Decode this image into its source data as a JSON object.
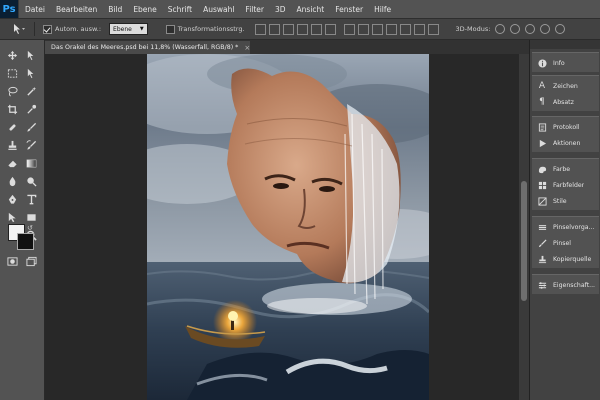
{
  "app": {
    "logo": "Ps"
  },
  "menu": [
    "Datei",
    "Bearbeiten",
    "Bild",
    "Ebene",
    "Schrift",
    "Auswahl",
    "Filter",
    "3D",
    "Ansicht",
    "Fenster",
    "Hilfe"
  ],
  "options": {
    "auto_select_label": "Autom. ausw.:",
    "auto_select_checked": true,
    "auto_select_value": "Ebene",
    "transform_label": "Transformationsstrg.",
    "transform_checked": false,
    "mode_3d_label": "3D-Modus:"
  },
  "document": {
    "tab_title": "Das Orakel des Meeres.psd bei 11,8% (Wasserfall, RGB/8) *",
    "close_glyph": "×"
  },
  "panels": [
    {
      "label": "Info",
      "icon": "info-icon"
    },
    {
      "label": "Zeichen",
      "icon": "character-icon"
    },
    {
      "label": "Absatz",
      "icon": "paragraph-icon"
    },
    {
      "label": "Protokoll",
      "icon": "history-icon"
    },
    {
      "label": "Aktionen",
      "icon": "actions-play-icon"
    },
    {
      "label": "Farbe",
      "icon": "color-icon"
    },
    {
      "label": "Farbfelder",
      "icon": "swatches-icon"
    },
    {
      "label": "Stile",
      "icon": "styles-icon"
    },
    {
      "label": "Pinselvorga...",
      "icon": "brush-presets-icon"
    },
    {
      "label": "Pinsel",
      "icon": "brush-icon"
    },
    {
      "label": "Kopierquelle",
      "icon": "clone-source-icon"
    },
    {
      "label": "Eigenschaft...",
      "icon": "properties-icon"
    }
  ],
  "colors": {
    "foreground": "#f2f2f2",
    "background": "#111111",
    "accent": "#31a8ff"
  }
}
